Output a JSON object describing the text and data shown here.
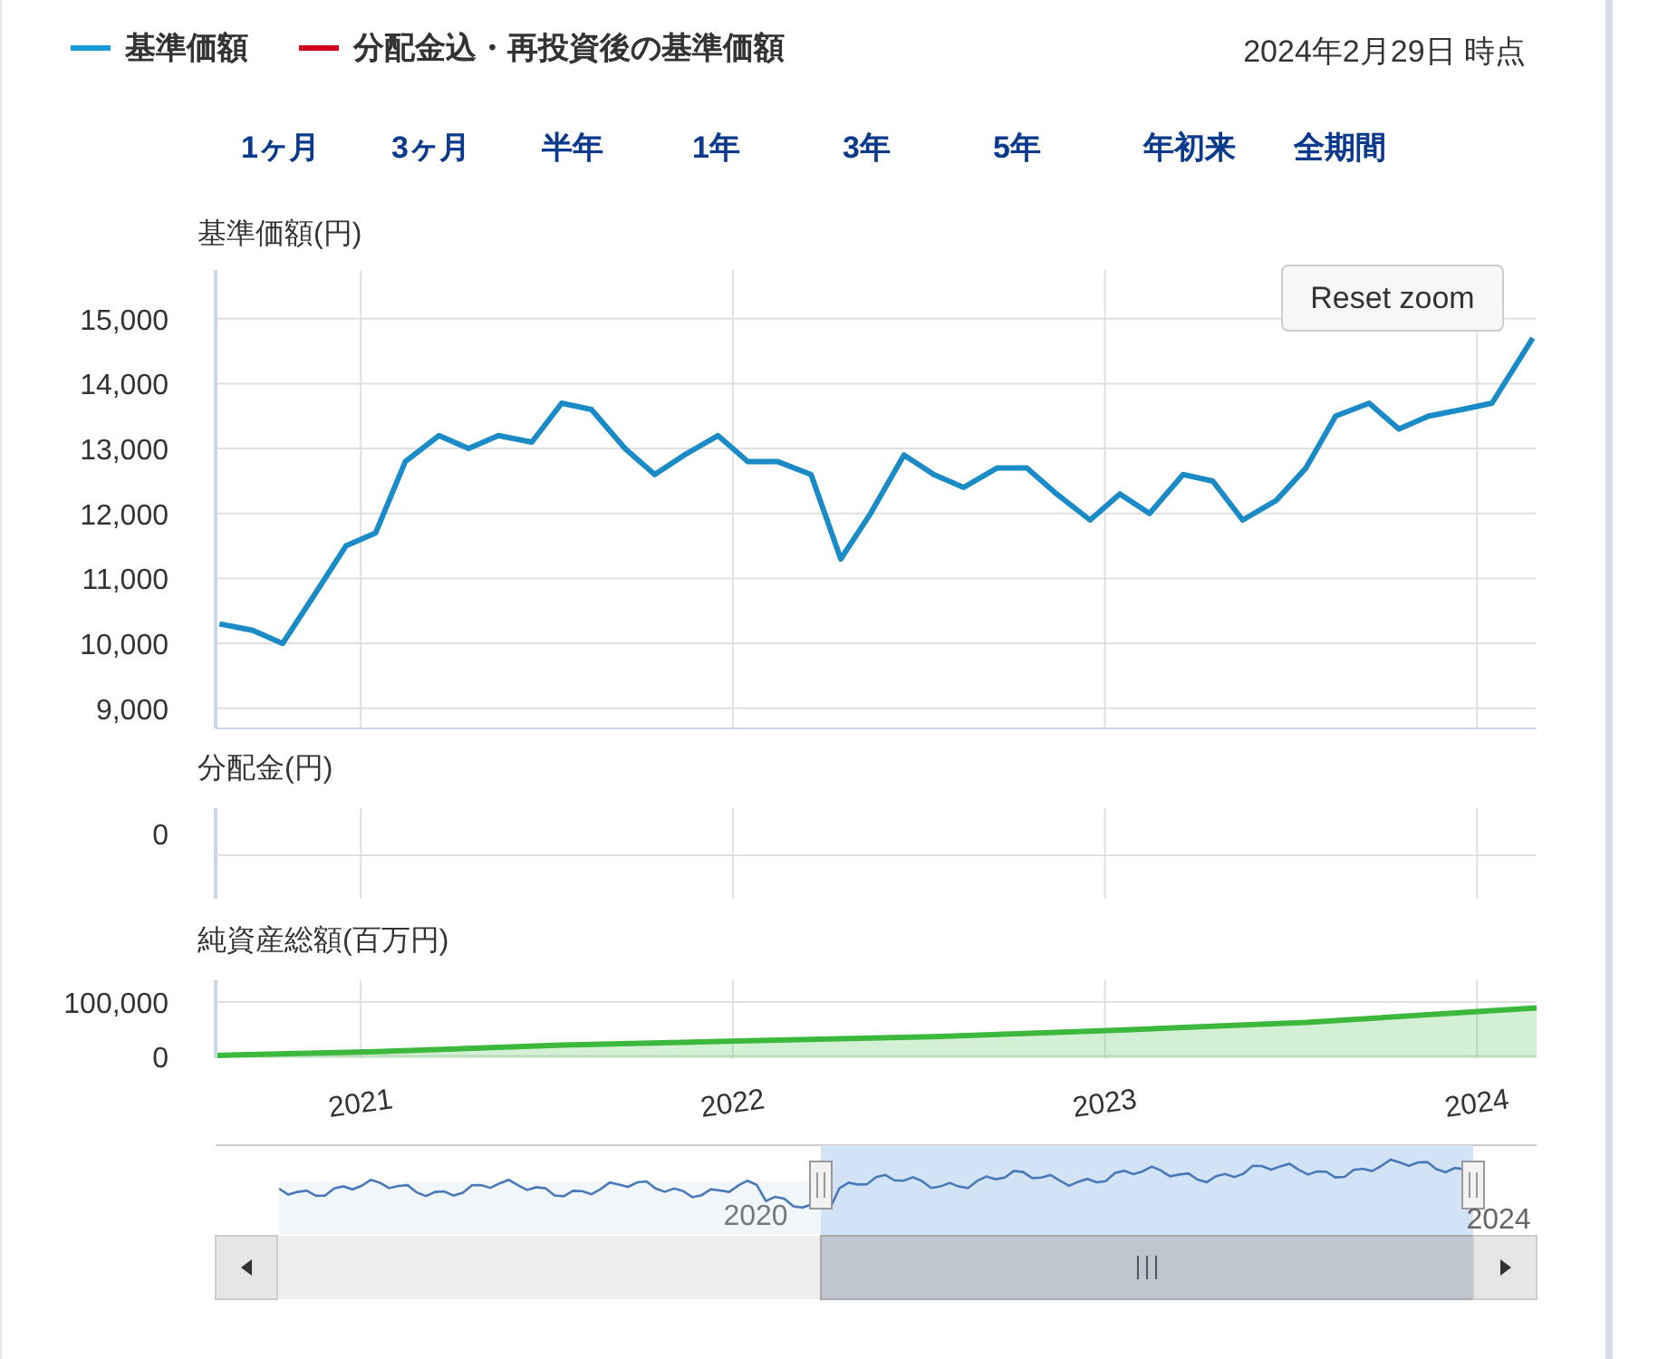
{
  "legend": [
    {
      "label": "基準価額",
      "color": "#1a9bd7"
    },
    {
      "label": "分配金込・再投資後の基準価額",
      "color": "#d0021b"
    }
  ],
  "as_of": "2024年2月29日 時点",
  "ranges": [
    {
      "label": "1ヶ月",
      "selected": false
    },
    {
      "label": "3ヶ月",
      "selected": false
    },
    {
      "label": "半年",
      "selected": false
    },
    {
      "label": "1年",
      "selected": false
    },
    {
      "label": "3年",
      "selected": false
    },
    {
      "label": "5年",
      "selected": false
    },
    {
      "label": "年初来",
      "selected": false
    },
    {
      "label": "全期間",
      "selected": false
    }
  ],
  "price_chart": {
    "reset_button": "Reset zoom",
    "chart_data": {
      "type": "line",
      "ylabel": "基準価額(円)",
      "grid": true,
      "x": [
        2020.62,
        2020.71,
        2020.79,
        2020.87,
        2020.96,
        2021.04,
        2021.12,
        2021.21,
        2021.29,
        2021.37,
        2021.46,
        2021.54,
        2021.62,
        2021.71,
        2021.79,
        2021.87,
        2021.96,
        2022.04,
        2022.12,
        2022.21,
        2022.29,
        2022.37,
        2022.46,
        2022.54,
        2022.62,
        2022.71,
        2022.79,
        2022.87,
        2022.96,
        2023.04,
        2023.12,
        2023.21,
        2023.29,
        2023.37,
        2023.46,
        2023.54,
        2023.62,
        2023.71,
        2023.79,
        2023.87,
        2023.96,
        2024.04,
        2024.15
      ],
      "series": [
        {
          "color": "#1a8bc6",
          "values": [
            10300,
            10200,
            10000,
            10700,
            11500,
            11700,
            12800,
            13200,
            13000,
            13200,
            13100,
            13700,
            13600,
            13000,
            12600,
            12900,
            13200,
            12800,
            12800,
            12600,
            11300,
            12000,
            12900,
            12600,
            12400,
            12700,
            12700,
            12300,
            11900,
            12300,
            12000,
            12600,
            12500,
            11900,
            12200,
            12700,
            13500,
            13700,
            13300,
            13500,
            13600,
            13700,
            14700
          ]
        }
      ],
      "xlim": [
        2020.61,
        2024.16
      ],
      "ylim": [
        8690,
        15750
      ],
      "yticks": [
        {
          "value": 9000,
          "label": "9,000"
        },
        {
          "value": 10000,
          "label": "10,000"
        },
        {
          "value": 11000,
          "label": "11,000"
        },
        {
          "value": 12000,
          "label": "12,000"
        },
        {
          "value": 13000,
          "label": "13,000"
        },
        {
          "value": 14000,
          "label": "14,000"
        },
        {
          "value": 15000,
          "label": "15,000"
        }
      ]
    }
  },
  "distribution_chart": {
    "title": "分配金(円)",
    "y_tick": "0"
  },
  "assets_chart": {
    "chart_data": {
      "type": "area",
      "ylabel": "純資産総額(百万円)",
      "grid": true,
      "x": [
        2020.61,
        2021.04,
        2021.54,
        2022.04,
        2022.54,
        2023.04,
        2023.54,
        2024.04,
        2024.16
      ],
      "series": [
        {
          "color": "#3cb93c",
          "values": [
            1000,
            8000,
            20000,
            28000,
            36000,
            48000,
            62000,
            84000,
            89000
          ]
        }
      ],
      "xlim": [
        2020.61,
        2024.16
      ],
      "ylim": [
        -4000,
        140000
      ],
      "yticks": [
        {
          "value": 0,
          "label": "0"
        },
        {
          "value": 100000,
          "label": "100,000"
        }
      ],
      "xticks": [
        {
          "value": 2021,
          "label": "2021"
        },
        {
          "value": 2022,
          "label": "2022"
        },
        {
          "value": 2023,
          "label": "2023"
        },
        {
          "value": 2024,
          "label": "2024"
        }
      ]
    }
  },
  "navigator": {
    "labels": [
      "2020",
      "2024"
    ]
  }
}
